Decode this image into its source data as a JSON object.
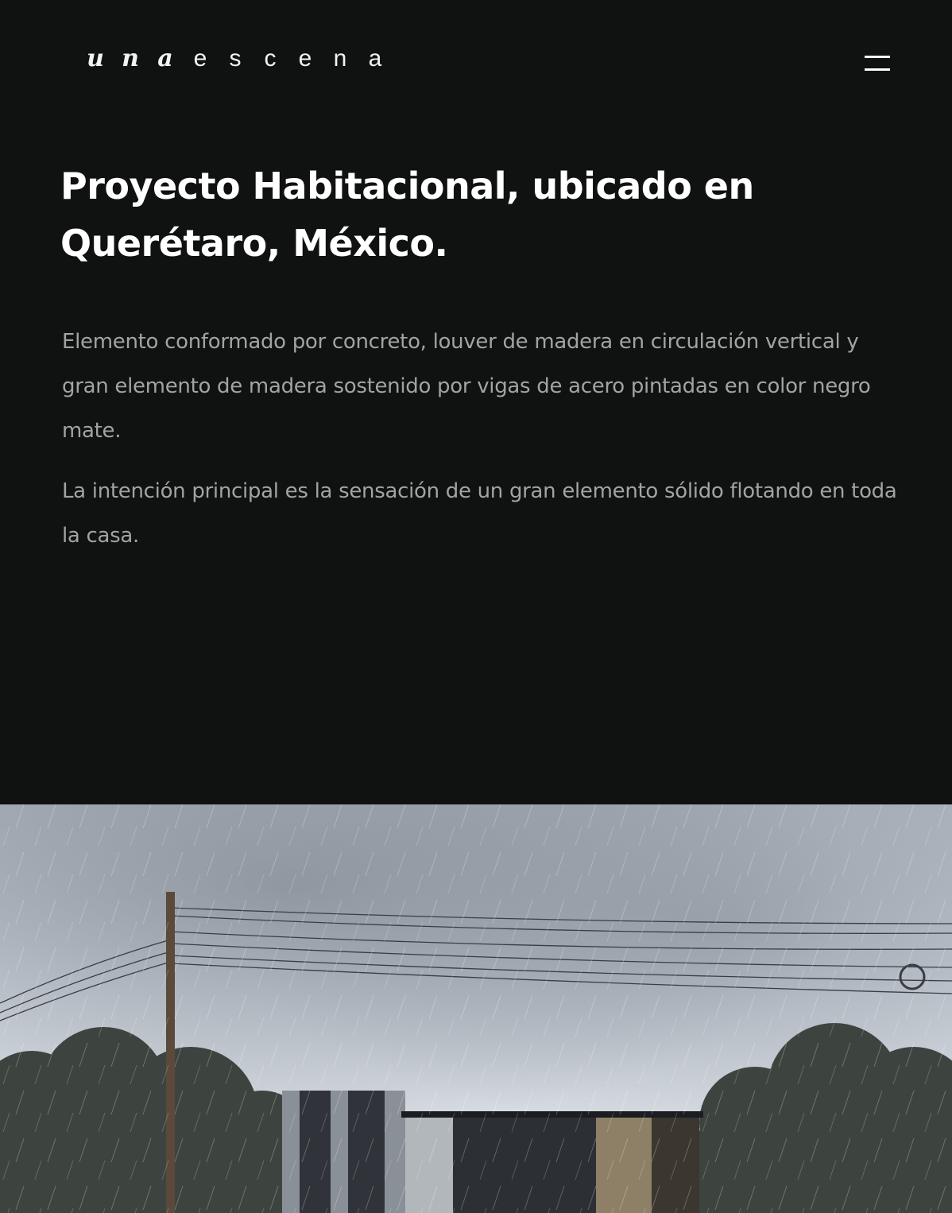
{
  "header": {
    "logo_letters": [
      "u",
      "n",
      "a",
      "e",
      "s",
      "c",
      "e",
      "n",
      "a"
    ],
    "menu_icon": "hamburger-menu-icon"
  },
  "project": {
    "title": "Proyecto Habitacional, ubicado en Querétaro, México.",
    "paragraphs": [
      "Elemento conformado por concreto, louver de madera en circulación vertical y gran elemento de madera sostenido por vigas de acero pintadas en color negro mate.",
      "La intención principal es la sensación de un gran elemento sólido flotando en toda la casa."
    ]
  },
  "hero_image": {
    "subject": "architectural-render-house-rain"
  },
  "colors": {
    "background": "#101111",
    "title": "#ffffff",
    "body_text": "#a3a3a3",
    "sky": "#c9d0d8",
    "trees": "#3d443f"
  }
}
